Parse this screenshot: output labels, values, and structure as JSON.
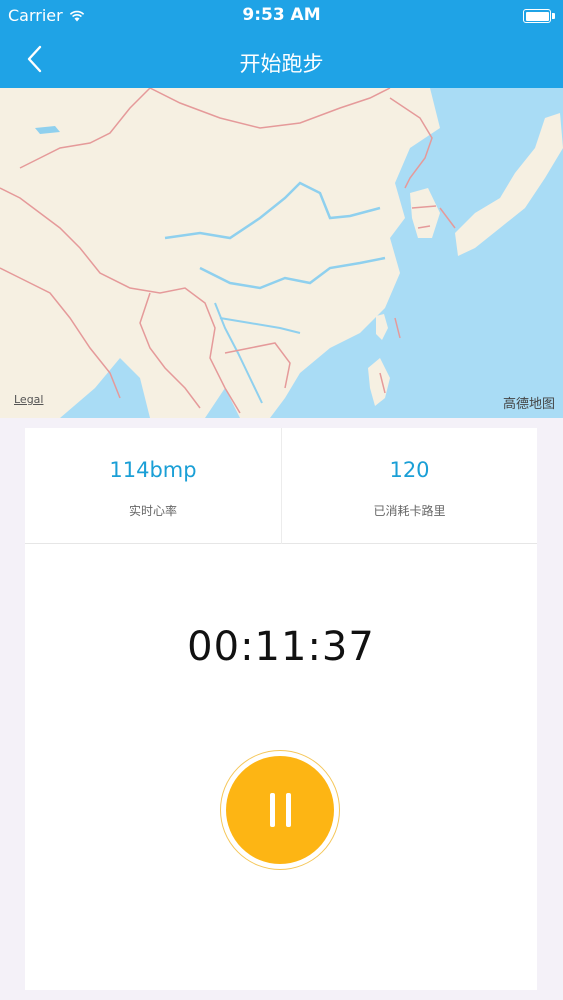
{
  "status_bar": {
    "carrier": "Carrier",
    "time": "9:53 AM"
  },
  "nav": {
    "title": "开始跑步",
    "back_icon": "chevron-left-icon"
  },
  "map": {
    "legal": "Legal",
    "provider": "高德地图",
    "colors": {
      "water": "#a9dcf5",
      "land": "#f6f0e2",
      "border": "#e59a9a",
      "river": "#8fd0ee"
    }
  },
  "stats": [
    {
      "value": "114bmp",
      "label": "实时心率"
    },
    {
      "value": "120",
      "label": "已消耗卡路里"
    }
  ],
  "timer": "00:11:37",
  "controls": {
    "pause_icon": "pause-icon",
    "accent": "#fdb514"
  },
  "theme": {
    "primary": "#1fa3e6"
  }
}
